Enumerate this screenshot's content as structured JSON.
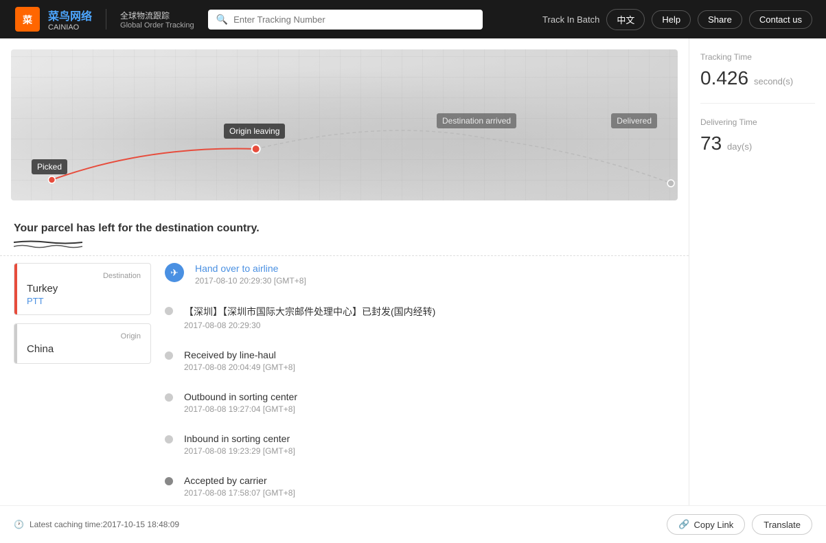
{
  "header": {
    "logo_cn": "菜鸟网络",
    "logo_en": "CAINIAO",
    "subtitle_cn": "全球物流跟踪",
    "subtitle_en": "Global Order Tracking",
    "search_placeholder": "Enter Tracking Number",
    "track_batch": "Track In Batch",
    "btn_lang": "中文",
    "btn_help": "Help",
    "btn_share": "Share",
    "btn_contact": "Contact us"
  },
  "map": {
    "stage_picked": "Picked",
    "stage_origin_leaving": "Origin leaving",
    "stage_destination_arrived": "Destination arrived",
    "stage_delivered": "Delivered"
  },
  "message": {
    "parcel_status": "Your parcel has left for the destination country."
  },
  "destination": {
    "label": "Destination",
    "country": "Turkey",
    "carrier": "PTT"
  },
  "origin": {
    "label": "Origin",
    "country": "China"
  },
  "timeline": [
    {
      "type": "active-icon",
      "title": "Hand over to airline",
      "title_color": "blue",
      "time": "2017-08-10 20:29:30 [GMT+8]"
    },
    {
      "type": "inactive",
      "title": "【深圳】【深圳市国际大宗邮件处理中心】已封发(国内经转)",
      "title_color": "normal",
      "time": "2017-08-08 20:29:30"
    },
    {
      "type": "inactive",
      "title": "Received by line-haul",
      "title_color": "normal",
      "time": "2017-08-08 20:04:49 [GMT+8]"
    },
    {
      "type": "inactive",
      "title": "Outbound in sorting center",
      "title_color": "normal",
      "time": "2017-08-08 19:27:04 [GMT+8]"
    },
    {
      "type": "inactive",
      "title": "Inbound in sorting center",
      "title_color": "normal",
      "time": "2017-08-08 19:23:29 [GMT+8]"
    },
    {
      "type": "inactive-dark",
      "title": "Accepted by carrier",
      "title_color": "normal",
      "time": "2017-08-08 17:58:07 [GMT+8]"
    }
  ],
  "sidebar": {
    "tracking_time_label": "Tracking Time",
    "tracking_value": "0.426",
    "tracking_unit": "second(s)",
    "delivering_time_label": "Delivering Time",
    "delivering_value": "73",
    "delivering_unit": "day(s)"
  },
  "footer": {
    "cache_text": "Latest caching time:2017-10-15 18:48:09",
    "copy_link": "Copy Link",
    "translate": "Translate"
  }
}
